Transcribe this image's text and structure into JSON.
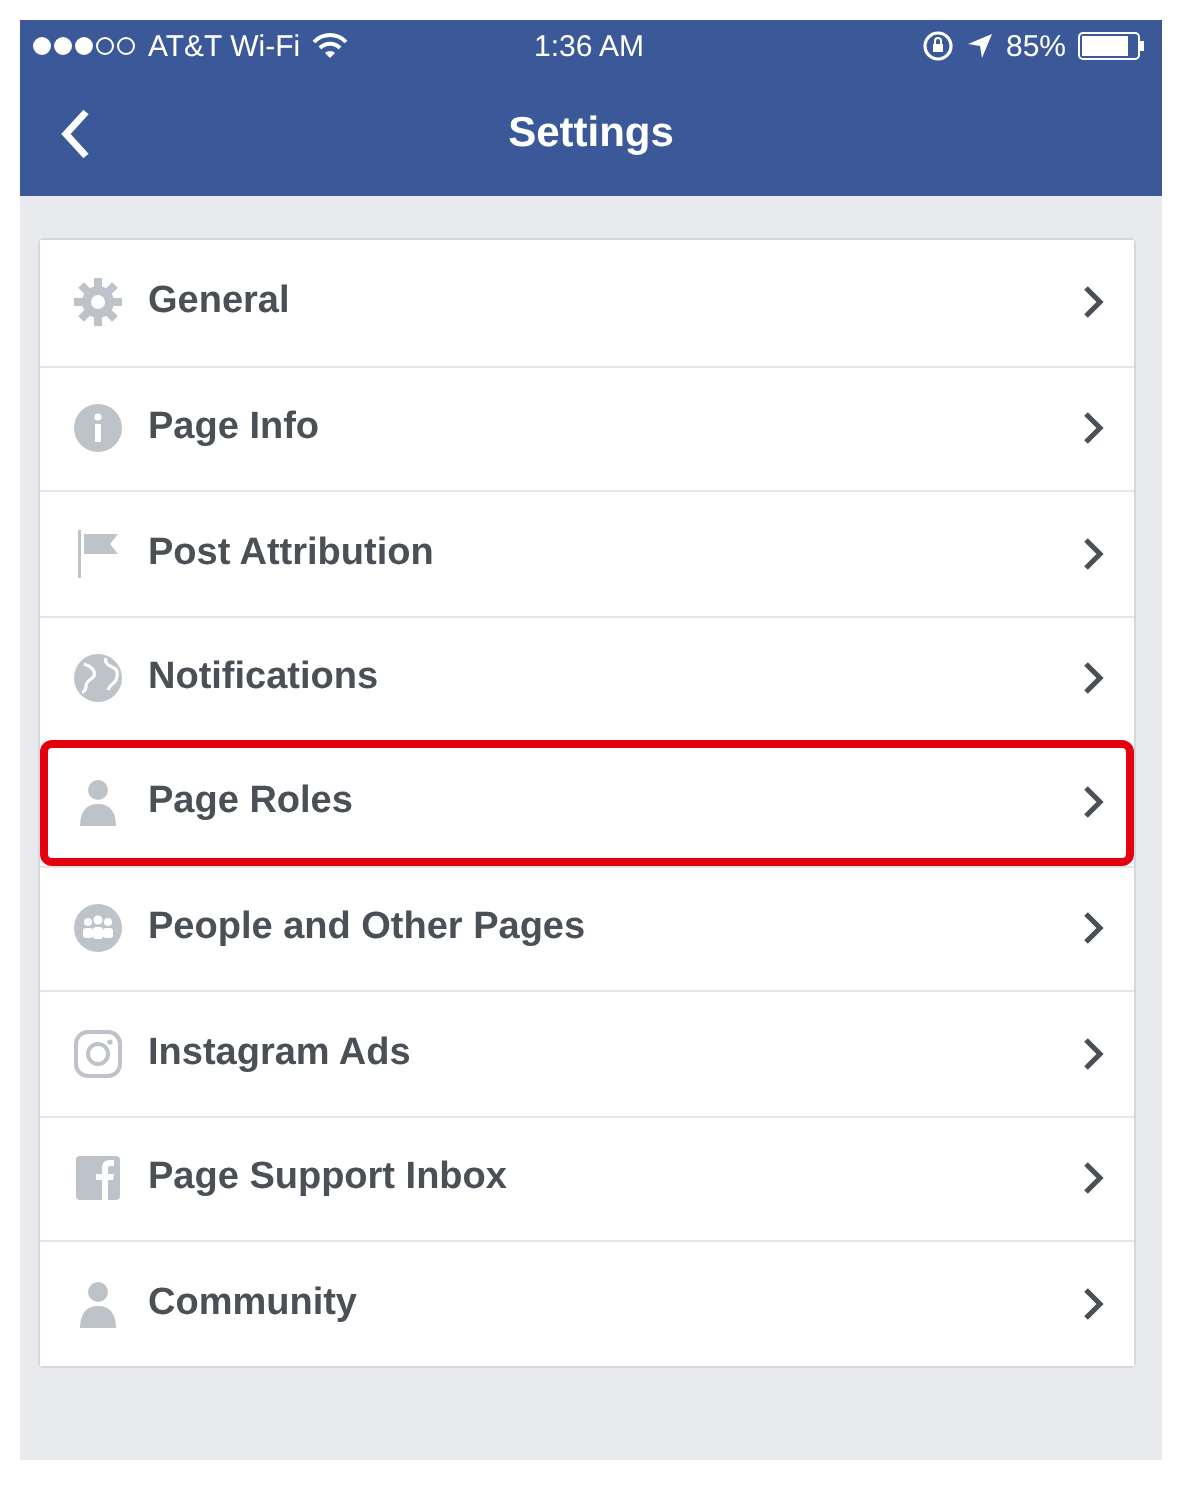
{
  "status_bar": {
    "carrier": "AT&T Wi-Fi",
    "time": "1:36 AM",
    "battery": "85%"
  },
  "nav_bar": {
    "title": "Settings"
  },
  "items": [
    {
      "label": "General",
      "kind": "gear",
      "highlighted": false
    },
    {
      "label": "Page Info",
      "kind": "info",
      "highlighted": false
    },
    {
      "label": "Post Attribution",
      "kind": "flag",
      "highlighted": false
    },
    {
      "label": "Notifications",
      "kind": "globe",
      "highlighted": false
    },
    {
      "label": "Page Roles",
      "kind": "person",
      "highlighted": true
    },
    {
      "label": "People and Other Pages",
      "kind": "group",
      "highlighted": false
    },
    {
      "label": "Instagram Ads",
      "kind": "camera",
      "highlighted": false
    },
    {
      "label": "Page Support Inbox",
      "kind": "square",
      "highlighted": false
    },
    {
      "label": "Community",
      "kind": "person",
      "highlighted": false
    }
  ]
}
